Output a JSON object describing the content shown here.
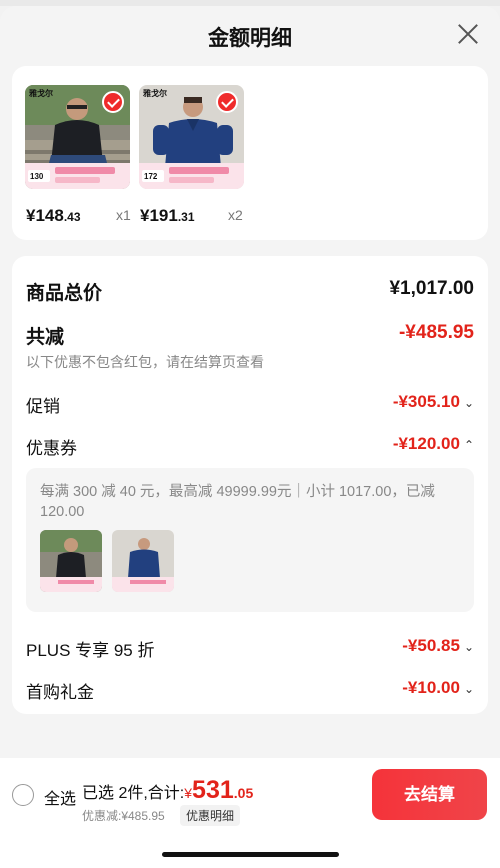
{
  "header": {
    "title": "金额明细"
  },
  "products": [
    {
      "price_main": "¥148",
      "price_small": ".43",
      "qty": "x1",
      "banner": "130"
    },
    {
      "price_main": "¥191",
      "price_small": ".31",
      "qty": "x2",
      "banner": "172"
    }
  ],
  "brand_text": "雅戈尔",
  "totals": {
    "goods_total_label": "商品总价",
    "goods_total_value": "¥1,017.00",
    "total_reduce_label": "共减",
    "total_reduce_value": "-¥485.95",
    "note": "以下优惠不包含红包，请在结算页查看",
    "promo_label": "促销",
    "promo_value": "-¥305.10",
    "coupon_label": "优惠券",
    "coupon_value": "-¥120.00",
    "coupon_detail": "每满 300 减 40 元，最高减 49999.99元｜小计 1017.00，已减 120.00",
    "plus_label": "PLUS 专享 95 折",
    "plus_value": "-¥50.85",
    "first_label": "首购礼金",
    "first_value": "-¥10.00"
  },
  "bottom": {
    "select_all": "全选",
    "summary_prefix": "已选 2件,合计:",
    "currency": "¥",
    "total_int": "531",
    "total_dec": ".05",
    "discount_text": "优惠减:¥485.95",
    "detail_button": "优惠明细",
    "checkout_button": "去结算"
  },
  "colors": {
    "accent_red": "#e2231a",
    "checkout_red": "#f5333a"
  }
}
